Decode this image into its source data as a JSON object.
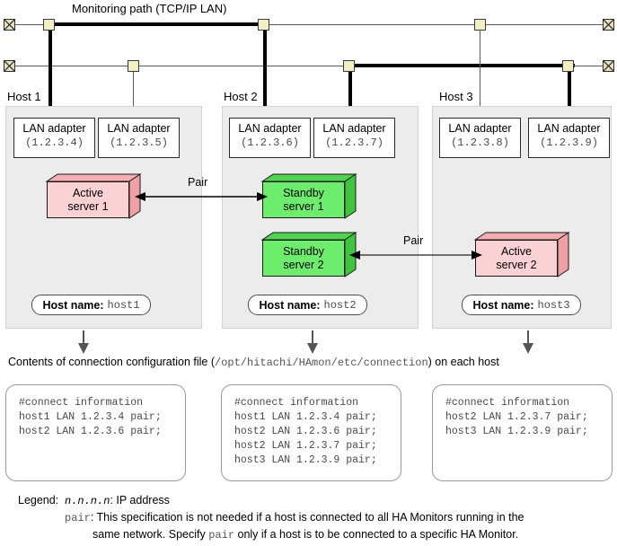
{
  "diagram": {
    "monitoring_path_label": "Monitoring path (TCP/IP LAN)",
    "pair_label_1": "Pair",
    "pair_label_2": "Pair"
  },
  "hosts": [
    {
      "title": "Host 1",
      "adapters": [
        {
          "name": "LAN adapter",
          "ip": "(1.2.3.4)"
        },
        {
          "name": "LAN adapter",
          "ip": "(1.2.3.5)"
        }
      ],
      "servers": [
        {
          "line1": "Active",
          "line2": "server 1",
          "color": "#fbd2d4",
          "kind": "active"
        }
      ],
      "hostname_key": "Host name:",
      "hostname_value": "host1"
    },
    {
      "title": "Host 2",
      "adapters": [
        {
          "name": "LAN adapter",
          "ip": "(1.2.3.6)"
        },
        {
          "name": "LAN adapter",
          "ip": "(1.2.3.7)"
        }
      ],
      "servers": [
        {
          "line1": "Standby",
          "line2": "server 1",
          "color": "#6ced6c",
          "kind": "standby"
        },
        {
          "line1": "Standby",
          "line2": "server 2",
          "color": "#6ced6c",
          "kind": "standby"
        }
      ],
      "hostname_key": "Host name:",
      "hostname_value": "host2"
    },
    {
      "title": "Host 3",
      "adapters": [
        {
          "name": "LAN adapter",
          "ip": "(1.2.3.8)"
        },
        {
          "name": "LAN adapter",
          "ip": "(1.2.3.9)"
        }
      ],
      "servers": [
        {
          "line1": "Active",
          "line2": "server 2",
          "color": "#fbd2d4",
          "kind": "active"
        }
      ],
      "hostname_key": "Host name:",
      "hostname_value": "host3"
    }
  ],
  "caption": {
    "prefix": "Contents of connection configuration file (",
    "path": "/opt/hitachi/HAmon/etc/connection",
    "suffix": ") on each host"
  },
  "config_files": [
    {
      "lines": [
        "#connect information",
        "host1 LAN 1.2.3.4 pair;",
        "host2 LAN 1.2.3.6 pair;"
      ]
    },
    {
      "lines": [
        "#connect information",
        "host1 LAN 1.2.3.4 pair;",
        "host2 LAN 1.2.3.6 pair;",
        "host2 LAN 1.2.3.7 pair;",
        "host3 LAN 1.2.3.9 pair;"
      ]
    },
    {
      "lines": [
        "#connect information",
        "host2 LAN 1.2.3.7 pair;",
        "host3 LAN 1.2.3.9 pair;"
      ]
    }
  ],
  "legend": {
    "lead": "Legend:",
    "row1_term": "n.n.n.n",
    "row1_text": ": IP address",
    "row2_term": "pair",
    "row2_text": ": This specification is not needed if a host is connected to all HA Monitors running in the",
    "row3_pre": "same network. Specify ",
    "row3_term": "pair",
    "row3_post": " only if a host is to be connected to a specific HA Monitor."
  }
}
